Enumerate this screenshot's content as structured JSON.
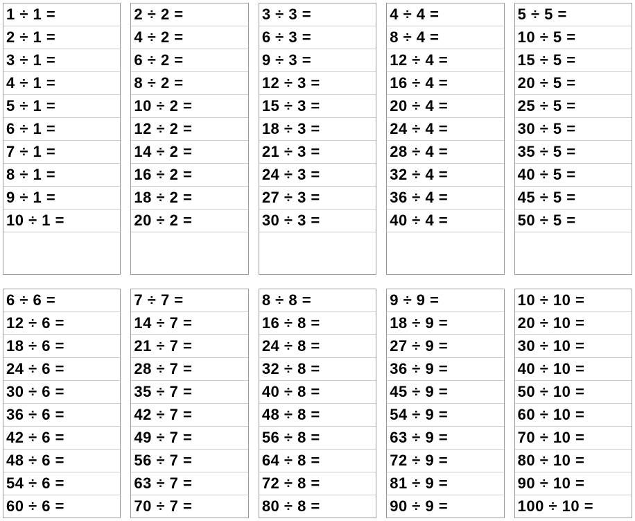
{
  "groups": [
    [
      [
        "1 ÷ 1 =",
        "2 ÷ 1 =",
        "3 ÷ 1 =",
        "4 ÷ 1 =",
        "5 ÷ 1 =",
        "6 ÷ 1 =",
        "7 ÷ 1 =",
        "8 ÷ 1 =",
        "9 ÷ 1 =",
        "10 ÷ 1 ="
      ],
      [
        "2 ÷ 2 =",
        "4 ÷ 2 =",
        "6 ÷ 2 =",
        "8 ÷ 2 =",
        "10 ÷ 2 =",
        "12 ÷ 2 =",
        "14 ÷ 2 =",
        "16 ÷ 2 =",
        "18 ÷ 2 =",
        "20 ÷ 2 ="
      ],
      [
        "3 ÷ 3 =",
        "6 ÷ 3 =",
        "9 ÷ 3 =",
        "12 ÷ 3 =",
        "15 ÷ 3 =",
        "18 ÷ 3 =",
        "21 ÷ 3 =",
        "24 ÷ 3 =",
        "27 ÷ 3 =",
        "30 ÷ 3 ="
      ],
      [
        "4 ÷ 4 =",
        "8 ÷ 4 =",
        "12 ÷ 4 =",
        "16 ÷ 4 =",
        "20 ÷ 4 =",
        "24 ÷ 4 =",
        "28 ÷ 4 =",
        "32 ÷ 4 =",
        "36 ÷ 4 =",
        "40 ÷ 4 ="
      ],
      [
        "5 ÷ 5 =",
        "10 ÷ 5 =",
        "15 ÷ 5 =",
        "20 ÷ 5 =",
        "25 ÷ 5 =",
        "30 ÷ 5 =",
        "35 ÷ 5 =",
        "40 ÷ 5 =",
        "45 ÷ 5 =",
        "50 ÷ 5 ="
      ]
    ],
    [
      [
        "6 ÷ 6 =",
        "12 ÷ 6 =",
        "18 ÷ 6 =",
        "24 ÷ 6 =",
        "30 ÷ 6 =",
        "36 ÷ 6 =",
        "42 ÷ 6 =",
        "48 ÷ 6 =",
        "54 ÷ 6 =",
        "60 ÷ 6 ="
      ],
      [
        "7 ÷ 7 =",
        "14 ÷ 7 =",
        "21 ÷ 7 =",
        "28 ÷ 7 =",
        "35 ÷ 7 =",
        "42 ÷ 7 =",
        "49 ÷ 7 =",
        "56 ÷ 7 =",
        "63 ÷ 7 =",
        "70 ÷ 7 ="
      ],
      [
        "8 ÷ 8 =",
        "16 ÷ 8 =",
        "24 ÷ 8 =",
        "32 ÷ 8 =",
        "40 ÷ 8 =",
        "48 ÷ 8 =",
        "56 ÷ 8 =",
        "64 ÷ 8 =",
        "72 ÷ 8 =",
        "80 ÷ 8 ="
      ],
      [
        "9 ÷ 9 =",
        "18 ÷ 9 =",
        "27 ÷ 9 =",
        "36 ÷ 9 =",
        "45 ÷ 9 =",
        "54 ÷ 9 =",
        "63 ÷ 9 =",
        "72 ÷ 9 =",
        "81 ÷ 9 =",
        "90 ÷ 9 ="
      ],
      [
        "10 ÷ 10 =",
        "20 ÷ 10 =",
        "30 ÷ 10 =",
        "40 ÷ 10 =",
        "50 ÷ 10 =",
        "60 ÷ 10 =",
        "70 ÷ 10 =",
        "80 ÷ 10 =",
        "90 ÷ 10 =",
        "100 ÷ 10 ="
      ]
    ]
  ]
}
